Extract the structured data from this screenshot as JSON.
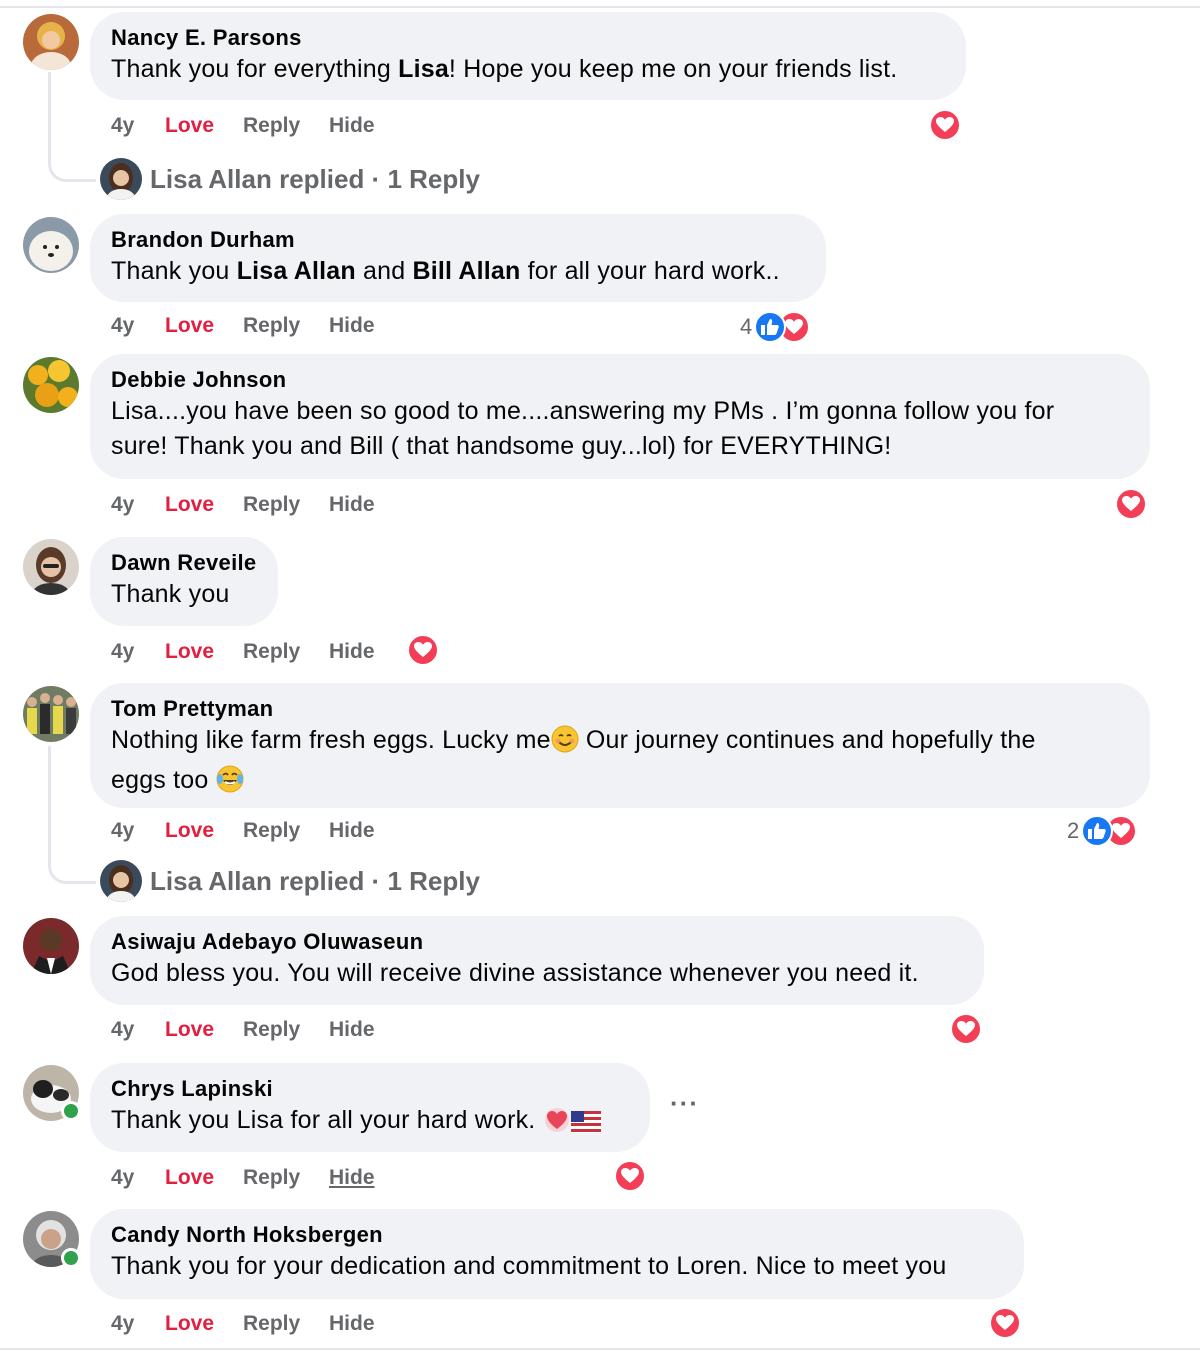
{
  "actions": {
    "time": "4y",
    "love": "Love",
    "reply": "Reply",
    "hide": "Hide"
  },
  "colors": {
    "love_red": "#e41e3f",
    "like_blue": "#1877f2",
    "reaction_love": "#f33e58",
    "bubble_bg": "#f0f2f5",
    "muted_text": "#65676b"
  },
  "more_button": "···",
  "comments": [
    {
      "author": "Nancy E. Parsons",
      "text_parts": [
        "Thank you for everything ",
        "Lisa",
        "! Hope you keep me on your friends list."
      ],
      "reactions": [
        "love"
      ],
      "reply_summary": {
        "name": "Lisa Allan replied",
        "sep": " · ",
        "count": "1 Reply"
      }
    },
    {
      "author": "Brandon Durham",
      "text_parts": [
        "Thank you ",
        "Lisa Allan",
        " and ",
        "Bill Allan",
        " for all your hard work.."
      ],
      "reaction_count": "4",
      "reactions": [
        "like",
        "love"
      ]
    },
    {
      "author": "Debbie Johnson",
      "text_lines": [
        "Lisa....you have been so good to me....answering my PMs . I’m gonna follow you for",
        "sure! Thank you and Bill ( that handsome guy...lol) for EVERYTHING!"
      ],
      "reactions": [
        "love"
      ]
    },
    {
      "author": "Dawn Reveile",
      "text": "Thank you",
      "reactions": [
        "love"
      ]
    },
    {
      "author": "Tom Prettyman",
      "text_lines": [
        "Nothing like farm fresh eggs. Lucky me",
        " Our journey continues and hopefully the",
        "eggs too "
      ],
      "emojis": [
        "smiling-face-emoji",
        "tears-of-joy-emoji"
      ],
      "reaction_count": "2",
      "reactions": [
        "like",
        "love"
      ],
      "reply_summary": {
        "name": "Lisa Allan replied",
        "sep": " · ",
        "count": "1 Reply"
      }
    },
    {
      "author": "Asiwaju Adebayo Oluwaseun",
      "text": "God bless you. You will receive divine assistance whenever you need it.",
      "reactions": [
        "love"
      ]
    },
    {
      "author": "Chrys Lapinski",
      "text": "Thank you Lisa for all your hard work. ",
      "emojis": [
        "heart-emoji",
        "us-flag-emoji"
      ],
      "reactions": [
        "love"
      ],
      "online": true,
      "hide_underlined": true
    },
    {
      "author": "Candy North Hoksbergen",
      "text": "Thank you for your dedication and commitment to Loren. Nice to meet you",
      "reactions": [
        "love"
      ],
      "online": true
    }
  ]
}
